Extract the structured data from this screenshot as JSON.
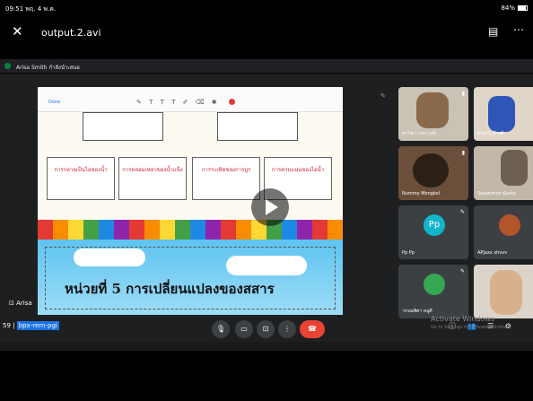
{
  "status_bar": {
    "time": "09:51",
    "date": "พฤ. 4 พ.ค.",
    "right": "84%"
  },
  "player": {
    "title": "output.2.avi"
  },
  "meet": {
    "presenter": "Arisa Smith กำลังนำเสนอ",
    "share_toolbar": {
      "done": "Done"
    },
    "slide": {
      "cards": [
        "การกลายเป็นไอของน้ำ",
        "การหลอมเหลวของน้ำแข็ง",
        "การระเหิดของการบูร",
        "การควบแน่นของไอน้ำ"
      ],
      "unit_title": "หน่วยที่ 5 การเปลี่ยนแปลงของสสาร"
    },
    "participants": [
      {
        "name": "พรรัชกา มหาวงษ์",
        "type": "video"
      },
      {
        "name": "ตนแก้ว มีวงศ์",
        "type": "video"
      },
      {
        "name": "Nummy Mongkol",
        "type": "video"
      },
      {
        "name": "Sasiwimon Kanta",
        "type": "video"
      },
      {
        "name": "Pp Pp",
        "type": "avatar",
        "initials": "Pp",
        "color": "#12b5cb"
      },
      {
        "name": "APJaxx shvvv",
        "type": "video"
      },
      {
        "name": "วรรณพิศา หนูดี",
        "type": "avatar",
        "initials": "",
        "color": "#34a853"
      },
      {
        "name": "",
        "type": "video"
      }
    ],
    "meeting_code": "bpx-rern-pgi",
    "self_label": "Arisa"
  },
  "watermark": {
    "line1": "Activate Windows",
    "line2": "Go to Settings to activate Windows."
  },
  "colors": {
    "end_call": "#ea4335",
    "accent": "#1a73e8",
    "bg": "#000000"
  }
}
